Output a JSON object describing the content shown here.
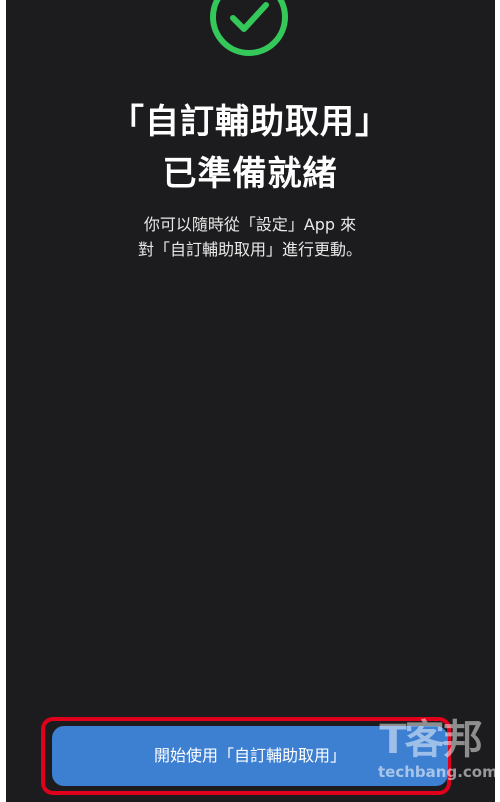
{
  "icons": {
    "status": "checkmark-circle-icon"
  },
  "colors": {
    "background": "#1c1c1e",
    "accent_green": "#34c759",
    "button_blue": "#3d7fd1",
    "highlight_red": "#e0001b"
  },
  "heading": {
    "line1": "「自訂輔助取用」",
    "line2": "已準備就緒"
  },
  "description": {
    "line1": "你可以隨時從「設定」App 來",
    "line2": "對「自訂輔助取用」進行更動。"
  },
  "primary_button": {
    "label": "開始使用「自訂輔助取用」"
  },
  "watermark": {
    "logo_text": "T客邦",
    "site": "techbang.com"
  }
}
